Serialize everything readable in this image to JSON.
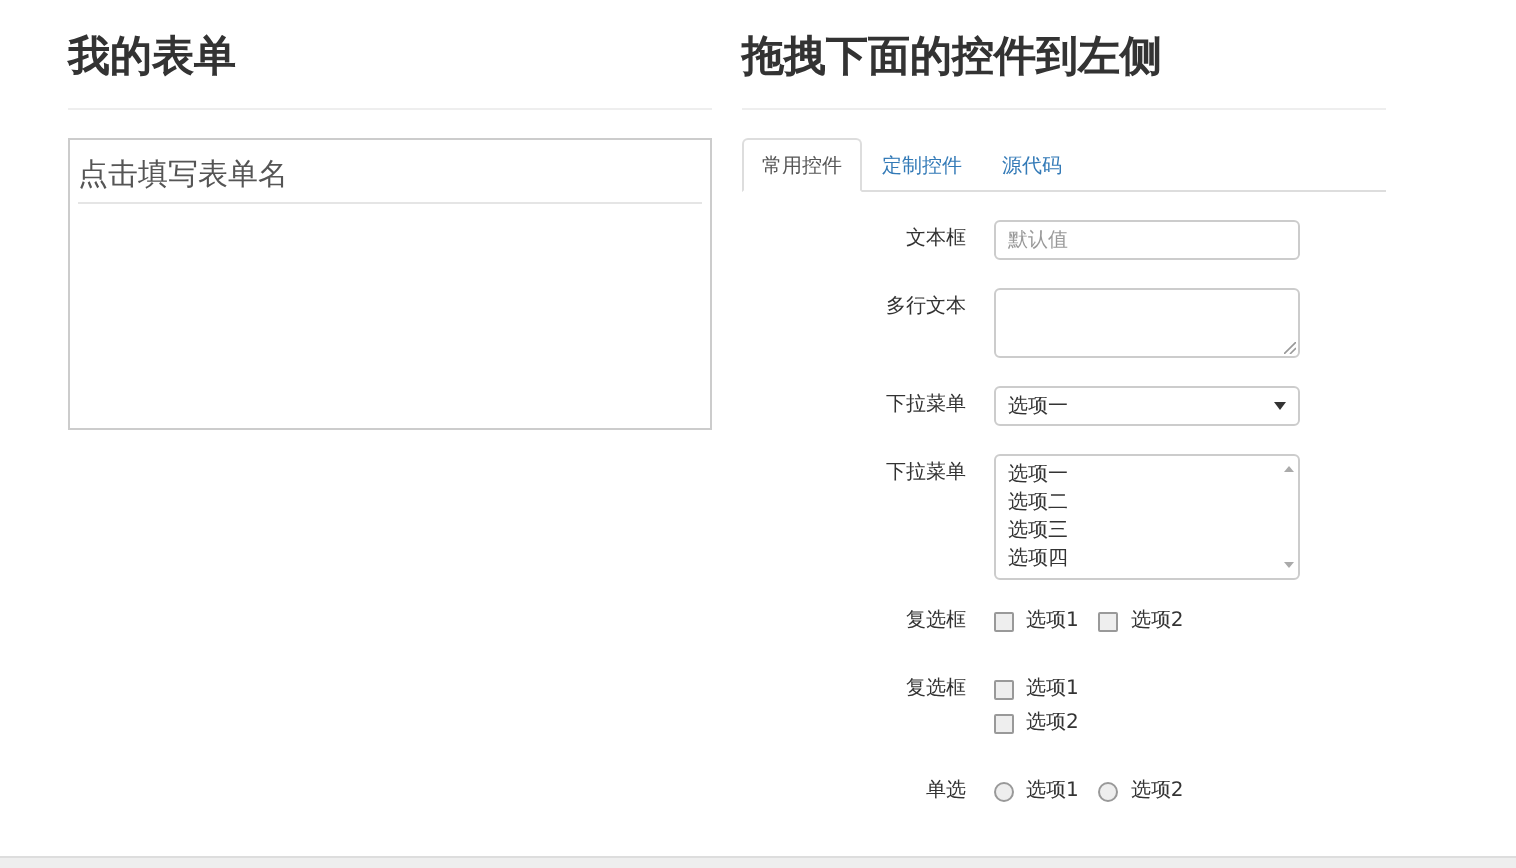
{
  "my_form": {
    "title": "我的表单",
    "form_name_placeholder": "点击填写表单名"
  },
  "palette": {
    "title": "拖拽下面的控件到左侧",
    "tabs": [
      {
        "label": "常用控件",
        "selected": true
      },
      {
        "label": "定制控件",
        "selected": false
      },
      {
        "label": "源代码",
        "selected": false
      }
    ],
    "controls": [
      {
        "kind": "text",
        "label": "文本框",
        "placeholder": "默认值"
      },
      {
        "kind": "textarea",
        "label": "多行文本"
      },
      {
        "kind": "select",
        "label": "下拉菜单",
        "value": "选项一"
      },
      {
        "kind": "listbox",
        "label": "下拉菜单",
        "options": [
          "选项一",
          "选项二",
          "选项三",
          "选项四"
        ]
      },
      {
        "kind": "checkbox-inline",
        "label": "复选框",
        "options": [
          {
            "label": "选项1",
            "checked": false
          },
          {
            "label": "选项2",
            "checked": false
          }
        ]
      },
      {
        "kind": "checkbox-stacked",
        "label": "复选框",
        "options": [
          {
            "label": "选项1",
            "checked": false
          },
          {
            "label": "选项2",
            "checked": false
          }
        ]
      },
      {
        "kind": "radio",
        "label": "单选",
        "options": [
          {
            "label": "选项1",
            "selected": false
          },
          {
            "label": "选项2",
            "selected": false
          }
        ]
      }
    ]
  }
}
